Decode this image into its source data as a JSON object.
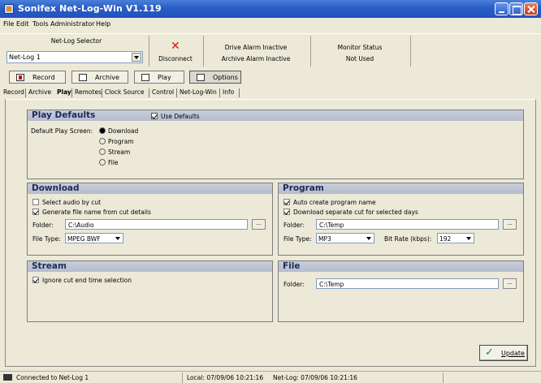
{
  "window": {
    "title": "Sonifex Net-Log-Win V1.119"
  },
  "menu": [
    "File",
    "Edit",
    "Tools",
    "Administrator",
    "Help"
  ],
  "selector": {
    "label": "Net-Log Selector",
    "value": "Net-Log 1"
  },
  "disconnect_label": "Disconnect",
  "alarms": {
    "drive": "Drive Alarm Inactive",
    "archive": "Archive Alarm Inactive"
  },
  "monitor": {
    "label": "Monitor Status",
    "value": "Not Used"
  },
  "modes": [
    "Record",
    "Archive",
    "Play",
    "Options"
  ],
  "tabs": [
    "Record",
    "Archive",
    "Play",
    "Remotes",
    "Clock Source",
    "Control",
    "Net-Log-Win",
    "Info"
  ],
  "play_defaults": {
    "title": "Play Defaults",
    "use_defaults": "Use Defaults",
    "screen_label": "Default Play Screen:",
    "options": [
      "Download",
      "Program",
      "Stream",
      "File"
    ],
    "selected": "Download"
  },
  "download": {
    "title": "Download",
    "select_by_cut": "Select audio by cut",
    "generate_name": "Generate file name from cut details",
    "folder_label": "Folder:",
    "folder_value": "C:\\Audio",
    "filetype_label": "File Type:",
    "filetype_value": "MPEG BWF",
    "browse": "..."
  },
  "program": {
    "title": "Program",
    "auto_create": "Auto create program name",
    "download_separate": "Download separate cut for selected days",
    "folder_label": "Folder:",
    "folder_value": "C:\\Temp",
    "filetype_label": "File Type:",
    "filetype_value": "MP3",
    "bitrate_label": "Bit Rate (kbps):",
    "bitrate_value": "192",
    "browse": "..."
  },
  "stream": {
    "title": "Stream",
    "ignore_cut": "Ignore cut end time selection"
  },
  "file": {
    "title": "File",
    "folder_label": "Folder:",
    "folder_value": "C:\\Temp",
    "browse": "..."
  },
  "update_label": "Update",
  "status": {
    "connection": "Connected to Net-Log 1",
    "local": "Local: 07/09/06 10:21:16",
    "netlog": "Net-Log: 07/09/06 10:21:16"
  },
  "colors": {
    "titlebar": "#2a5cc6",
    "panel_header": "#b9c0cf",
    "window_bg": "#ece9d8",
    "disconnect": "#d11111",
    "update_check": "#1a8a1a"
  },
  "icons": [
    "app-icon",
    "disconnect-icon",
    "record-icon",
    "archive-icon",
    "play-icon",
    "options-icon",
    "update-check-icon",
    "status-connection-icon"
  ]
}
